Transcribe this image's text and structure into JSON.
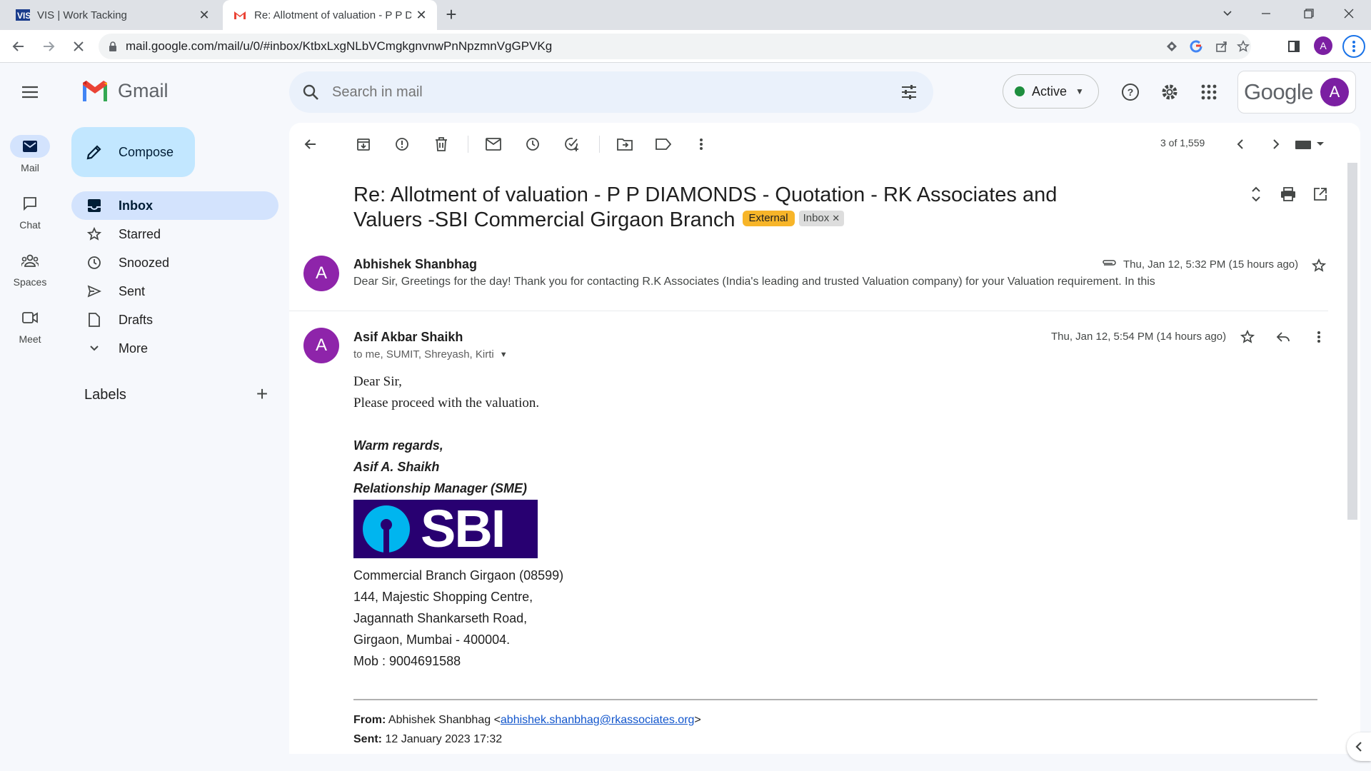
{
  "browser": {
    "tabs": [
      {
        "title": "VIS | Work Tacking",
        "favicon": "vis-logo-icon"
      },
      {
        "title": "Re: Allotment of valuation - P P D",
        "favicon": "gmail-icon"
      }
    ],
    "url": "mail.google.com/mail/u/0/#inbox/KtbxLxgNLbVCmgkgnvnwPnNpzmnVgGPVKg",
    "profile_initial": "A"
  },
  "header": {
    "app_name": "Gmail",
    "search_placeholder": "Search in mail",
    "status": "Active",
    "google_word": "Google",
    "avatar_initial": "A"
  },
  "rail": [
    {
      "label": "Mail",
      "icon": "mail-icon"
    },
    {
      "label": "Chat",
      "icon": "chat-icon"
    },
    {
      "label": "Spaces",
      "icon": "spaces-icon"
    },
    {
      "label": "Meet",
      "icon": "meet-icon"
    }
  ],
  "nav": {
    "compose_label": "Compose",
    "items": [
      {
        "label": "Inbox",
        "icon": "inbox-icon"
      },
      {
        "label": "Starred",
        "icon": "star-icon"
      },
      {
        "label": "Snoozed",
        "icon": "clock-icon"
      },
      {
        "label": "Sent",
        "icon": "send-icon"
      },
      {
        "label": "Drafts",
        "icon": "draft-icon"
      },
      {
        "label": "More",
        "icon": "chevron-down-icon"
      }
    ],
    "labels_heading": "Labels"
  },
  "thread": {
    "pager": "3 of 1,559",
    "subject": "Re: Allotment of valuation - P P DIAMONDS - Quotation - RK Associates and Valuers -SBI Commercial Girgaon Branch",
    "chips": {
      "external": "External",
      "inbox": "Inbox"
    },
    "messages": [
      {
        "initial": "A",
        "sender": "Abhishek Shanbhag",
        "date": "Thu, Jan 12, 5:32 PM (15 hours ago)",
        "snippet": "Dear Sir, Greetings for the day! Thank you for contacting R.K Associates (India's leading and trusted Valuation company) for your Valuation requirement. In this"
      },
      {
        "initial": "A",
        "sender": "Asif Akbar Shaikh",
        "date": "Thu, Jan 12, 5:54 PM (14 hours ago)",
        "recipients": "to me, SUMIT, Shreyash, Kirti"
      }
    ],
    "body": {
      "greeting": "Dear Sir,",
      "line1": "Please proceed with the valuation.",
      "sig_regards": "Warm  regards,",
      "sig_name": "Asif  A.  Shaikh",
      "sig_title": "Relationship Manager (SME)",
      "logo_text": "SBI",
      "address": [
        "Commercial Branch Girgaon (08599)",
        "144, Majestic Shopping Centre,",
        "Jagannath Shankarseth Road,",
        "Girgaon, Mumbai - 400004.",
        "Mob : 9004691588"
      ],
      "quoted": {
        "from_label": "From:",
        "from_name": "Abhishek Shanbhag <",
        "from_email": "abhishek.shanbhag@rkassociates.org",
        "from_close": ">",
        "sent_label": "Sent:",
        "sent_value": "12 January 2023 17:32"
      }
    }
  },
  "colors": {
    "accent": "#0b57d0",
    "compose_bg": "#c2e7ff",
    "active_nav": "#d3e3fd",
    "external_chip": "#f7b529",
    "avatar": "#8e24aa",
    "sbi_navy": "#280071",
    "sbi_blue": "#00b5ef"
  }
}
